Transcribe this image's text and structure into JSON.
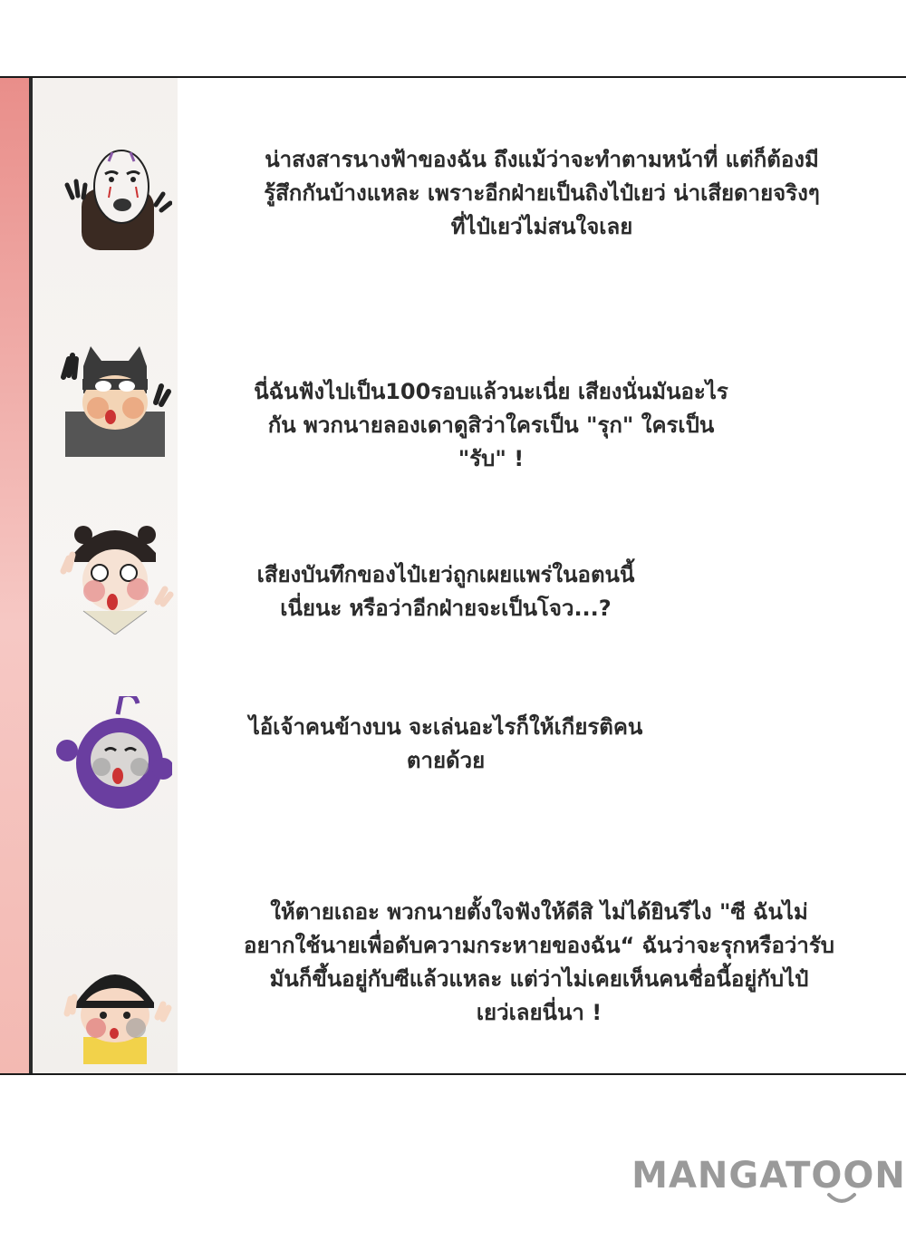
{
  "comments": [
    {
      "avatar": "no-face-mask-avatar",
      "lines": [
        "น่าสงสารนางฟ้าของฉัน ถึงแม้ว่าจะทำตามหน้าที่ แต่ก็ต้องมี",
        "รู้สึกกันบ้างแหละ เพราะอีกฝ่ายเป็นถิงไป๋เยว่ น่าเสียดายจริงๆ",
        "ที่ไป๋เยว่ไม่สนใจเลย"
      ]
    },
    {
      "avatar": "batman-avatar",
      "lines": [
        "นี่ฉันฟังไปเป็น100รอบแล้วนะเนี่ย เสียงนั่นมันอะไร",
        "กัน พวกนายลองเดาดูสิว่าใครเป็น \"รุก\" ใครเป็น",
        "\"รับ\" !"
      ]
    },
    {
      "avatar": "ancient-lady-avatar",
      "lines": [
        "เสียงบันทึกของไป๋เยว่ถูกเผยแพร่ในอตนนี้",
        "เนี่ยนะ หรือว่าอีกฝ่ายจะเป็นโจว...?"
      ]
    },
    {
      "avatar": "purple-teletubby-avatar",
      "lines": [
        "ไอ้เจ้าคนข้างบน จะเล่นอะไรก็ให้เกียรติคน",
        "ตายด้วย"
      ]
    },
    {
      "avatar": "bowl-cut-girl-avatar",
      "lines": [
        "ให้ตายเถอะ พวกนายตั้งใจฟังให้ดีสิ ไม่ได้ยินรึไง \"ซี ฉันไม่",
        "อยากใช้นายเพื่อดับความกระหายของฉัน“ ฉันว่าจะรุกหรือว่ารับ",
        "มันก็ขึ้นอยู่กับซีแล้วแหละ แต่ว่าไม่เคยเห็นคนชื่อนี้อยู่กับไป๋",
        "เยว่เลยนี่นา !"
      ]
    }
  ],
  "watermark": {
    "text": "MANGATOON",
    "color": "#9a9a9a"
  },
  "colors": {
    "edge_strip": "#e98e8a",
    "text": "#2b2b2b",
    "border": "#1a1a1a"
  }
}
